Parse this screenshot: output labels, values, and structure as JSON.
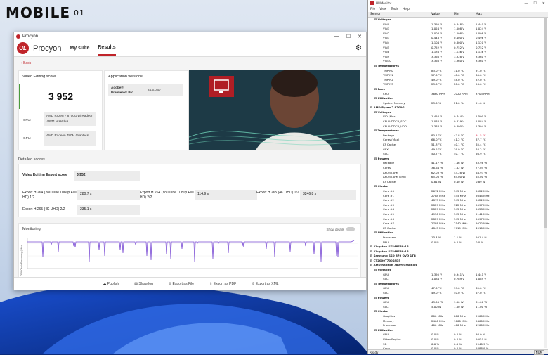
{
  "watermark": {
    "brand": "MOBILE",
    "suffix": "01"
  },
  "procyon": {
    "window_title": "Procyon",
    "brand": "Procyon",
    "tabs": [
      "My suite",
      "Results"
    ],
    "back": "Back",
    "score_card": {
      "title": "Video Editing score",
      "score": "3 952",
      "cpu_label": "CPU:",
      "cpu": "AMD Ryzen 7 8700G w/ Radeon 780M Graphics",
      "gpu_label": "GPU:",
      "gpu": "AMD Radeon 780M Graphics"
    },
    "apps_card": {
      "title": "Application versions",
      "app": "Adobe® Premiere® Pro",
      "version": "24.5.0.57"
    },
    "detailed": {
      "title": "Detailed scores",
      "export_score_label": "Video Editing Export score",
      "export_score": "3 952",
      "items": [
        {
          "label": "Export H.264 (YouTube 1080p Full HD) 1/2",
          "value": "280.7 s"
        },
        {
          "label": "Export H.264 (YouTube 1080p Full HD) 2/2",
          "value": "114.9 s"
        },
        {
          "label": "Export H.265 (4K UHD) 1/2",
          "value": "3246.8 s"
        },
        {
          "label": "Export H.265 (4K UHD) 2/2",
          "value": "235.1 s"
        }
      ]
    },
    "monitoring": {
      "title": "Monitoring",
      "toggle": "Show details",
      "ylabel": "CPU Clock Frequency (MHz)"
    },
    "footer": [
      "Publish",
      "Show log",
      "Export as File",
      "Export as PDF",
      "Export as XML"
    ]
  },
  "hwmonitor": {
    "title": "HWMonitor",
    "menu": [
      "File",
      "View",
      "Tools",
      "Help"
    ],
    "headers": [
      "Sensor",
      "Value",
      "Min",
      "Max"
    ],
    "rows": [
      {
        "n": "Voltages",
        "g": true,
        "i": 1
      },
      {
        "n": "VIN0",
        "v": "1.392 V",
        "mn": "0.848 V",
        "mx": "1.440 V",
        "i": 3
      },
      {
        "n": "VIN1",
        "v": "1.024 V",
        "mn": "1.008 V",
        "mx": "1.024 V",
        "i": 3
      },
      {
        "n": "VIN2",
        "v": "1.008 V",
        "mn": "1.008 V",
        "mx": "1.008 V",
        "i": 3
      },
      {
        "n": "VIN3",
        "v": "0.448 V",
        "mn": "0.400 V",
        "mx": "0.496 V",
        "i": 3
      },
      {
        "n": "VIN4",
        "v": "1.104 V",
        "mn": "0.800 V",
        "mx": "1.120 V",
        "i": 3
      },
      {
        "n": "VIN5",
        "v": "0.752 V",
        "mn": "0.752 V",
        "mx": "0.752 V",
        "i": 3
      },
      {
        "n": "VIN8",
        "v": "1.136 V",
        "mn": "1.136 V",
        "mx": "1.136 V",
        "i": 3
      },
      {
        "n": "VIN9",
        "v": "3.360 V",
        "mn": "3.328 V",
        "mx": "3.360 V",
        "i": 3
      },
      {
        "n": "VIN10",
        "v": "3.360 V",
        "mn": "3.360 V",
        "mx": "3.360 V",
        "i": 3
      },
      {
        "n": "Temperatures",
        "g": true,
        "i": 1
      },
      {
        "n": "TMPIN0",
        "v": "83.0 °C",
        "mn": "31.0 °C",
        "mx": "91.0 °C",
        "i": 3
      },
      {
        "n": "TMPIN1",
        "v": "57.0 °C",
        "mn": "48.0 °C",
        "mx": "60.0 °C",
        "i": 3
      },
      {
        "n": "TMPIN2",
        "v": "49.0 °C",
        "mn": "48.0 °C",
        "mx": "52.0 °C",
        "i": 3
      },
      {
        "n": "TMPIN3",
        "v": "23.0 °C",
        "mn": "28.0 °C",
        "mx": "26.0 °C",
        "i": 3
      },
      {
        "n": "Fans",
        "g": true,
        "i": 1
      },
      {
        "n": "CPU",
        "v": "3660 RPM",
        "mn": "2020 RPM",
        "mx": "3703 RPM",
        "i": 3
      },
      {
        "n": "Utilization",
        "g": true,
        "i": 1
      },
      {
        "n": "System Memory",
        "v": "23.0 %",
        "mn": "21.0 %",
        "mx": "51.0 %",
        "i": 3
      },
      {
        "n": "AMD Ryzen 7 8700G",
        "g": true,
        "i": 0
      },
      {
        "n": "Voltages",
        "g": true,
        "i": 1
      },
      {
        "n": "VID (Max)",
        "v": "1.456 V",
        "mn": "0.744 V",
        "mx": "1.500 V",
        "i": 3
      },
      {
        "n": "CPU VDDCR_SOC",
        "v": "1.084 V",
        "mn": "0.819 V",
        "mx": "1.084 V",
        "i": 3
      },
      {
        "n": "CPU VDDCR_VDD",
        "v": "1.388 V",
        "mn": "0.890 V",
        "mx": "1.394 V",
        "i": 3
      },
      {
        "n": "Temperatures",
        "g": true,
        "i": 1
      },
      {
        "n": "Package",
        "v": "80.1 °C",
        "mn": "47.8 °C",
        "mx": "91.5 °C",
        "i": 3,
        "red": true
      },
      {
        "n": "Cores (Max)",
        "v": "66.0 °C",
        "mn": "41.2 °C",
        "mx": "87.7 °C",
        "i": 3
      },
      {
        "n": "L3 Cache",
        "v": "51.3 °C",
        "mn": "40.1 °C",
        "mx": "65.4 °C",
        "i": 3
      },
      {
        "n": "GFX",
        "v": "49.2 °C",
        "mn": "39.9 °C",
        "mx": "64.2 °C",
        "i": 3
      },
      {
        "n": "SoC",
        "v": "50.7 °C",
        "mn": "40.7 °C",
        "mx": "66.9 °C",
        "i": 3
      },
      {
        "n": "Powers",
        "g": true,
        "i": 1
      },
      {
        "n": "Package",
        "v": "41.17 W",
        "mn": "7.46 W",
        "mx": "83.98 W",
        "i": 3
      },
      {
        "n": "Cores",
        "v": "36.64 W",
        "mn": "1.62 W",
        "mx": "77.05 W",
        "i": 3
      },
      {
        "n": "APU STAPM",
        "v": "62.03 W",
        "mn": "44.28 W",
        "mx": "64.93 W",
        "i": 3
      },
      {
        "n": "APU STAPM Limit",
        "v": "65.00 W",
        "mn": "65.00 W",
        "mx": "65.00 W",
        "i": 3
      },
      {
        "n": "L3 Cache",
        "v": "0.81 W",
        "mn": "0.40 W",
        "mx": "0.89 W",
        "i": 3
      },
      {
        "n": "Clocks",
        "g": true,
        "i": 1
      },
      {
        "n": "Core #0",
        "v": "2672 MHz",
        "mn": "545 MHz",
        "mx": "5022 MHz",
        "i": 3
      },
      {
        "n": "Core #1",
        "v": "2788 MHz",
        "mn": "545 MHz",
        "mx": "5044 MHz",
        "i": 3
      },
      {
        "n": "Core #2",
        "v": "4875 MHz",
        "mn": "545 MHz",
        "mx": "5022 MHz",
        "i": 3
      },
      {
        "n": "Core #3",
        "v": "2829 MHz",
        "mn": "522 MHz",
        "mx": "5097 MHz",
        "i": 3
      },
      {
        "n": "Core #4",
        "v": "2829 MHz",
        "mn": "545 MHz",
        "mx": "5058 MHz",
        "i": 3
      },
      {
        "n": "Core #5",
        "v": "4950 MHz",
        "mn": "545 MHz",
        "mx": "5141 MHz",
        "i": 3
      },
      {
        "n": "Core #6",
        "v": "2829 MHz",
        "mn": "545 MHz",
        "mx": "5097 MHz",
        "i": 3
      },
      {
        "n": "Core #7",
        "v": "2788 MHz",
        "mn": "2540 MHz",
        "mx": "5022 MHz",
        "i": 3
      },
      {
        "n": "L3 Cache",
        "v": "4845 MHz",
        "mn": "1719 MHz",
        "mx": "4910 MHz",
        "i": 3
      },
      {
        "n": "Utilization",
        "g": true,
        "i": 1
      },
      {
        "n": "Processor",
        "v": "13.4 %",
        "mn": "1.1 %",
        "mx": "101.4 %",
        "i": 3
      },
      {
        "n": "NPU",
        "v": "0.0 %",
        "mn": "0.0 %",
        "mx": "0.0 %",
        "i": 3
      },
      {
        "n": "Kingston KF548S38-16",
        "g": true,
        "i": 0
      },
      {
        "n": "Kingston KF548S38-16",
        "g": true,
        "i": 0
      },
      {
        "n": "Samsung SSD 870 QVO 1TB",
        "g": true,
        "i": 0
      },
      {
        "n": "CT2000T700SSD5",
        "g": true,
        "i": 0
      },
      {
        "n": "AMD Radeon 780M Graphics",
        "g": true,
        "i": 0
      },
      {
        "n": "Voltages",
        "g": true,
        "i": 1
      },
      {
        "n": "GPU",
        "v": "1.395 V",
        "mn": "0.941 V",
        "mx": "1.441 V",
        "i": 3
      },
      {
        "n": "SoC",
        "v": "1.084 V",
        "mn": "0.789 V",
        "mx": "1.089 V",
        "i": 3
      },
      {
        "n": "Temperatures",
        "g": true,
        "i": 1
      },
      {
        "n": "GPU",
        "v": "47.0 °C",
        "mn": "39.0 °C",
        "mx": "65.0 °C",
        "i": 3
      },
      {
        "n": "SoC",
        "v": "49.0 °C",
        "mn": "40.0 °C",
        "mx": "67.0 °C",
        "i": 3
      },
      {
        "n": "Powers",
        "g": true,
        "i": 1
      },
      {
        "n": "GPU",
        "v": "43.00 W",
        "mn": "9.00 W",
        "mx": "81.00 W",
        "i": 3
      },
      {
        "n": "SoC",
        "v": "5.00 W",
        "mn": "1.00 W",
        "mx": "11.00 W",
        "i": 3
      },
      {
        "n": "Clocks",
        "g": true,
        "i": 1
      },
      {
        "n": "Graphics",
        "v": "800 MHz",
        "mn": "800 MHz",
        "mx": "2900 MHz",
        "i": 3
      },
      {
        "n": "Memory",
        "v": "2400 MHz",
        "mn": "1000 MHz",
        "mx": "2400 MHz",
        "i": 3
      },
      {
        "n": "Processor",
        "v": "400 MHz",
        "mn": "400 MHz",
        "mx": "1200 MHz",
        "i": 3
      },
      {
        "n": "Utilization",
        "g": true,
        "i": 1
      },
      {
        "n": "GPU",
        "v": "0.0 %",
        "mn": "0.0 %",
        "mx": "98.0 %",
        "i": 3
      },
      {
        "n": "Video Engine",
        "v": "0.0 %",
        "mn": "0.0 %",
        "mx": "100.0 %",
        "i": 3
      },
      {
        "n": "3D",
        "v": "0.0 %",
        "mn": "0.0 %",
        "mx": "2940.9 %",
        "i": 3
      },
      {
        "n": "Copy",
        "v": "0.0 %",
        "mn": "0.0 %",
        "mx": "2888.9 %",
        "i": 3
      }
    ],
    "status": "Ready",
    "status_num": "NUM"
  }
}
